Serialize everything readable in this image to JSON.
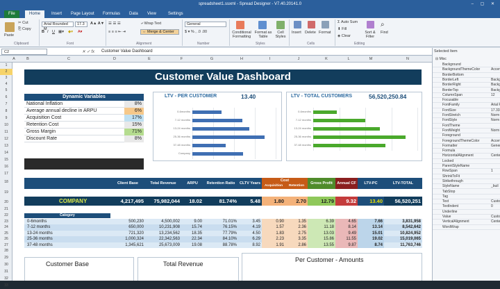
{
  "window": {
    "title": "spreadsheet1.ssxml - Spread Designer - V7.40.20141.0"
  },
  "tabs": {
    "file": "File",
    "home": "Home",
    "insert": "Insert",
    "page_layout": "Page Layout",
    "formulas": "Formulas",
    "data": "Data",
    "view": "View",
    "settings": "Settings"
  },
  "ribbon": {
    "paste": "Paste",
    "cut": "Cut",
    "copy": "Copy",
    "font_name": "Arial Rounded M",
    "font_size": "17.3",
    "wrap_text": "Wrap Text",
    "merge_center": "Merge & Center",
    "number_format": "General",
    "conditional_formatting": "Conditional Formatting",
    "format_as_table": "Format as Table",
    "cell_styles": "Cell Styles",
    "insert": "Insert",
    "delete": "Delete",
    "format": "Format",
    "autosum": "Auto Sum",
    "fill": "Fill",
    "clear": "Clear",
    "sort_filter": "Sort & Filter",
    "find": "Find",
    "group_clipboard": "Clipboard",
    "group_font": "Font",
    "group_alignment": "Alignment",
    "group_number": "Number",
    "group_styles": "Styles",
    "group_cells": "Cells",
    "group_editing": "Editing"
  },
  "formula_bar": {
    "name": "C2",
    "formula": "Customer Value Dashboard"
  },
  "columns": [
    "A",
    "B",
    "C",
    "D",
    "E",
    "F",
    "G",
    "H",
    "I",
    "J",
    "K",
    "L",
    "M",
    "N"
  ],
  "rows": [
    "1",
    "2",
    "3",
    "4",
    "5",
    "6",
    "7",
    "8",
    "9",
    "10",
    "11",
    "12",
    "13",
    "14",
    "15",
    "16",
    "17",
    "18",
    "19",
    "20",
    "21",
    "22",
    "23",
    "24",
    "25",
    "26",
    "27",
    "28",
    "29",
    "30",
    "31",
    "32",
    "33"
  ],
  "dashboard": {
    "title": "Customer Value Dashboard",
    "dynamic_title": "Dynamic Variables",
    "variables": [
      {
        "label": "National Inflation",
        "value": "8%"
      },
      {
        "label": "Average annual decline in ARPU",
        "value": "6%"
      },
      {
        "label": "Acquisition Cost",
        "value": "17%"
      },
      {
        "label": "Retention Cost",
        "value": "15%"
      },
      {
        "label": "Gross Margin",
        "value": "71%"
      },
      {
        "label": "Discount Rate",
        "value": "8%"
      }
    ],
    "ltv_pc_title": "LTV - PER CUSTOMER",
    "ltv_pc_value": "13.40",
    "ltv_total_title": "LTV - TOTAL CUSTOMERS",
    "ltv_total_value": "56,520,250.84",
    "metric_headers": [
      "Client Base",
      "Total Revenue",
      "ARPU",
      "Retention Ratio",
      "CLTV Years",
      "Cost",
      "Gross Profit",
      "Annual CF",
      "LTV-PC",
      "LTV-TOTAL"
    ],
    "cost_sub": [
      "Acquisition",
      "Retention"
    ],
    "company": {
      "label": "COMPANY",
      "values": [
        "4,217,495",
        "75,982,044",
        "18.02",
        "81.74%",
        "5.48",
        "1.80",
        "2.70",
        "12.79",
        "9.32",
        "13.40",
        "56,520,251"
      ]
    },
    "category_label": "Category",
    "categories": [
      {
        "name": "0-6months",
        "values": [
          "500,230",
          "4,500,002",
          "9.00",
          "71.01%",
          "3.45",
          "0.90",
          "1.35",
          "6.39",
          "4.65",
          "7.66",
          "3,831,958"
        ]
      },
      {
        "name": "7-12 months",
        "values": [
          "650,000",
          "10,231,908",
          "15.74",
          "76.15%",
          "4.19",
          "1.57",
          "2.36",
          "11.18",
          "8.14",
          "13.14",
          "8,542,642"
        ]
      },
      {
        "name": "13-24 months",
        "values": [
          "721,320",
          "13,234,562",
          "18.35",
          "77.79%",
          "4.50",
          "1.83",
          "2.75",
          "13.03",
          "9.49",
          "15.01",
          "10,824,952"
        ]
      },
      {
        "name": "25-36 months",
        "values": [
          "1,000,324",
          "22,342,563",
          "22.34",
          "84.10%",
          "6.29",
          "2.23",
          "3.35",
          "15.86",
          "11.55",
          "19.02",
          "15,019,065"
        ]
      },
      {
        "name": "37-48 months",
        "values": [
          "1,345,621",
          "25,673,009",
          "19.08",
          "88.78%",
          "8.92",
          "1.91",
          "2.86",
          "13.55",
          "9.87",
          "8.74",
          "11,763,746"
        ]
      }
    ],
    "bottom": {
      "customer_base": "Customer Base",
      "total_revenue": "Total Revenue",
      "per_customer": "Per Customer - Amounts"
    }
  },
  "panel": {
    "title": "Selected Item",
    "section": "Misc",
    "props": [
      {
        "name": "Background",
        "value": ""
      },
      {
        "name": "BackgroundThemeColor",
        "value": "Accen"
      },
      {
        "name": "BorderBottom",
        "value": ""
      },
      {
        "name": "BorderLeft",
        "value": "Backg"
      },
      {
        "name": "BorderRight",
        "value": "Backg"
      },
      {
        "name": "BorderTop",
        "value": "Backg"
      },
      {
        "name": "ColumnSpan",
        "value": "12"
      },
      {
        "name": "Focusable",
        "value": ""
      },
      {
        "name": "FontFamily",
        "value": "Arial R"
      },
      {
        "name": "FontSize",
        "value": "17.333"
      },
      {
        "name": "FontStretch",
        "value": "Norm"
      },
      {
        "name": "FontStyle",
        "value": "Norm"
      },
      {
        "name": "FontTheme",
        "value": ""
      },
      {
        "name": "FontWeight",
        "value": "Norm"
      },
      {
        "name": "Foreground",
        "value": ""
      },
      {
        "name": "ForegroundThemeColor",
        "value": "Accen"
      },
      {
        "name": "Formatter",
        "value": "Gener"
      },
      {
        "name": "Formula",
        "value": ""
      },
      {
        "name": "HorizontalAlignment",
        "value": "Cente"
      },
      {
        "name": "Locked",
        "value": ""
      },
      {
        "name": "ParentStyleName",
        "value": ""
      },
      {
        "name": "RowSpan",
        "value": "1"
      },
      {
        "name": "ShrinkToFit",
        "value": ""
      },
      {
        "name": "Strikethrough",
        "value": ""
      },
      {
        "name": "StyleName",
        "value": "_buil"
      },
      {
        "name": "TabStop",
        "value": ""
      },
      {
        "name": "Tag",
        "value": ""
      },
      {
        "name": "Text",
        "value": "Custo"
      },
      {
        "name": "TextIndent",
        "value": "0"
      },
      {
        "name": "Underline",
        "value": ""
      },
      {
        "name": "Value",
        "value": "Custo"
      },
      {
        "name": "VerticalAlignment",
        "value": "Cente"
      },
      {
        "name": "WordWrap",
        "value": ""
      }
    ]
  },
  "colors": {
    "title_bar": "#2b5f9c",
    "dashboard_dark": "#123d5c",
    "bar_blue": "#3f6fb3",
    "bar_green": "#4aa92c",
    "highlight_row": "#f6d36a"
  },
  "chart_data": [
    {
      "type": "bar",
      "title": "LTV - PER CUSTOMER",
      "categories": [
        "0-6months",
        "7-12 months",
        "13-24 months",
        "25-36 months",
        "37-48 months",
        "Company"
      ],
      "values": [
        7.66,
        13.14,
        15.01,
        19.02,
        8.74,
        13.4
      ],
      "xlim": [
        0,
        22
      ]
    },
    {
      "type": "bar",
      "title": "LTV - TOTAL CUSTOMERS",
      "categories": [
        "0-6months",
        "7-12 months",
        "13-24 months",
        "25-36 months",
        "37-48 months"
      ],
      "values": [
        3831958,
        8542642,
        10824952,
        15019065,
        11763746
      ],
      "xlim": [
        0,
        17000000
      ]
    }
  ]
}
